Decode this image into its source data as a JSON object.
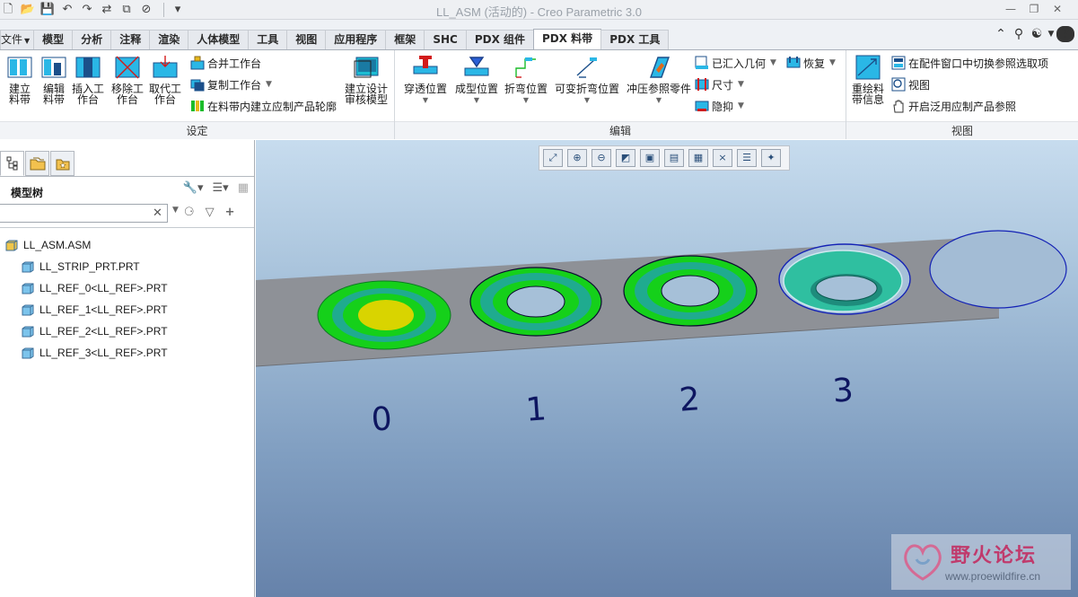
{
  "window": {
    "title": "LL_ASM (活动的) - Creo Parametric 3.0"
  },
  "quick_access": [
    "new-icon",
    "open-icon",
    "save-icon",
    "undo-icon",
    "redo-icon",
    "regenerate-icon",
    "windows-icon",
    "close-window-icon",
    "customize-icon"
  ],
  "tabs": [
    {
      "label": "文件",
      "file": true
    },
    {
      "label": "模型"
    },
    {
      "label": "分析"
    },
    {
      "label": "注释"
    },
    {
      "label": "渲染"
    },
    {
      "label": "人体模型"
    },
    {
      "label": "工具"
    },
    {
      "label": "视图"
    },
    {
      "label": "应用程序"
    },
    {
      "label": "框架"
    },
    {
      "label": "SHC"
    },
    {
      "label": "PDX 组件"
    },
    {
      "label": "PDX 料带",
      "active": true
    },
    {
      "label": "PDX 工具"
    }
  ],
  "ribbon": {
    "setup": {
      "label": "设定",
      "big": [
        "建立\n料带",
        "编辑\n料带",
        "插入工\n作台",
        "移除工\n作台",
        "取代工\n作台"
      ],
      "small": [
        "合并工作台",
        "复制工作台",
        "在料带内建立应制产品轮廓"
      ],
      "big_right": "建立设计\n审核模型"
    },
    "edit": {
      "label": "编辑",
      "big": [
        "穿透位置",
        "成型位置",
        "折弯位置",
        "可变折弯位置",
        "冲压参照零件"
      ],
      "small": [
        "已汇入几何",
        "尺寸",
        "隐抑",
        "恢复"
      ]
    },
    "view": {
      "label": "视图",
      "big": "重绘料\n带信息",
      "small": [
        "在配件窗口中切换参照选取项",
        "视图",
        "开启泛用应制产品参照"
      ]
    }
  },
  "model_tree": {
    "title": "模型树",
    "search_value": "",
    "items": [
      {
        "label": "LL_ASM.ASM",
        "type": "asm",
        "level": 0
      },
      {
        "label": "LL_STRIP_PRT.PRT",
        "type": "prt",
        "level": 1
      },
      {
        "label": "LL_REF_0<LL_REF>.PRT",
        "type": "prt",
        "level": 1
      },
      {
        "label": "LL_REF_1<LL_REF>.PRT",
        "type": "prt",
        "level": 1
      },
      {
        "label": "LL_REF_2<LL_REF>.PRT",
        "type": "prt",
        "level": 1
      },
      {
        "label": "LL_REF_3<LL_REF>.PRT",
        "type": "prt",
        "level": 1
      }
    ]
  },
  "viewport": {
    "station_labels": [
      "0",
      "1",
      "2",
      "3"
    ],
    "toolbar": [
      "refit-icon",
      "zoom-in-icon",
      "zoom-out-icon",
      "repaint-icon",
      "display-style-icon",
      "saved-views-icon",
      "view-manager-icon",
      "datum-display-icon",
      "annotation-display-icon",
      "spin-center-icon"
    ],
    "colors": {
      "strip": "#8e9197",
      "ring_outer": "#15d01a",
      "ring_inner": "#1fab8f",
      "center": "#d9d400",
      "outline": "#1422b5",
      "label": "#0e1660"
    }
  },
  "watermark": {
    "text": "野火论坛",
    "url": "www.proewildfire.cn"
  }
}
